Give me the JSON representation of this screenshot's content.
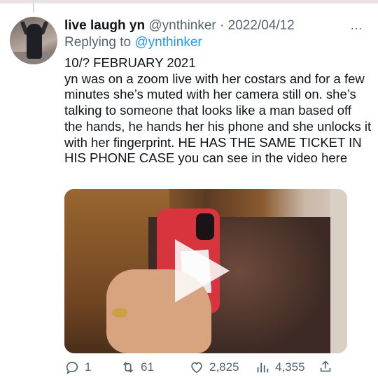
{
  "tweet": {
    "display_name": "live laugh yn",
    "handle": "@ynthinker",
    "separator": "·",
    "date": "2022/04/12",
    "more_icon": "…",
    "replying_prefix": "Replying to",
    "replying_to": "@ynthinker",
    "text": "10/? FEBRUARY 2021\nyn was on a zoom live with her costars and for a few minutes she’s muted with her camera still on. she’s talking to someone that looks like a man based off the hands, he hands her his phone and she unlocks it with her fingerprint. HE HAS THE SAME TICKET IN HIS PHONE CASE you can see in the video here"
  },
  "actions": {
    "replies": "1",
    "retweets": "61",
    "likes": "2,825",
    "views": "4,355"
  },
  "icons": {
    "reply": "reply-icon",
    "retweet": "retweet-icon",
    "like": "heart-icon",
    "views": "analytics-icon",
    "share": "share-icon",
    "play": "play-icon"
  },
  "colors": {
    "link": "#1d9bf0",
    "secondary_text": "#536471",
    "primary_text": "#0f1419"
  }
}
